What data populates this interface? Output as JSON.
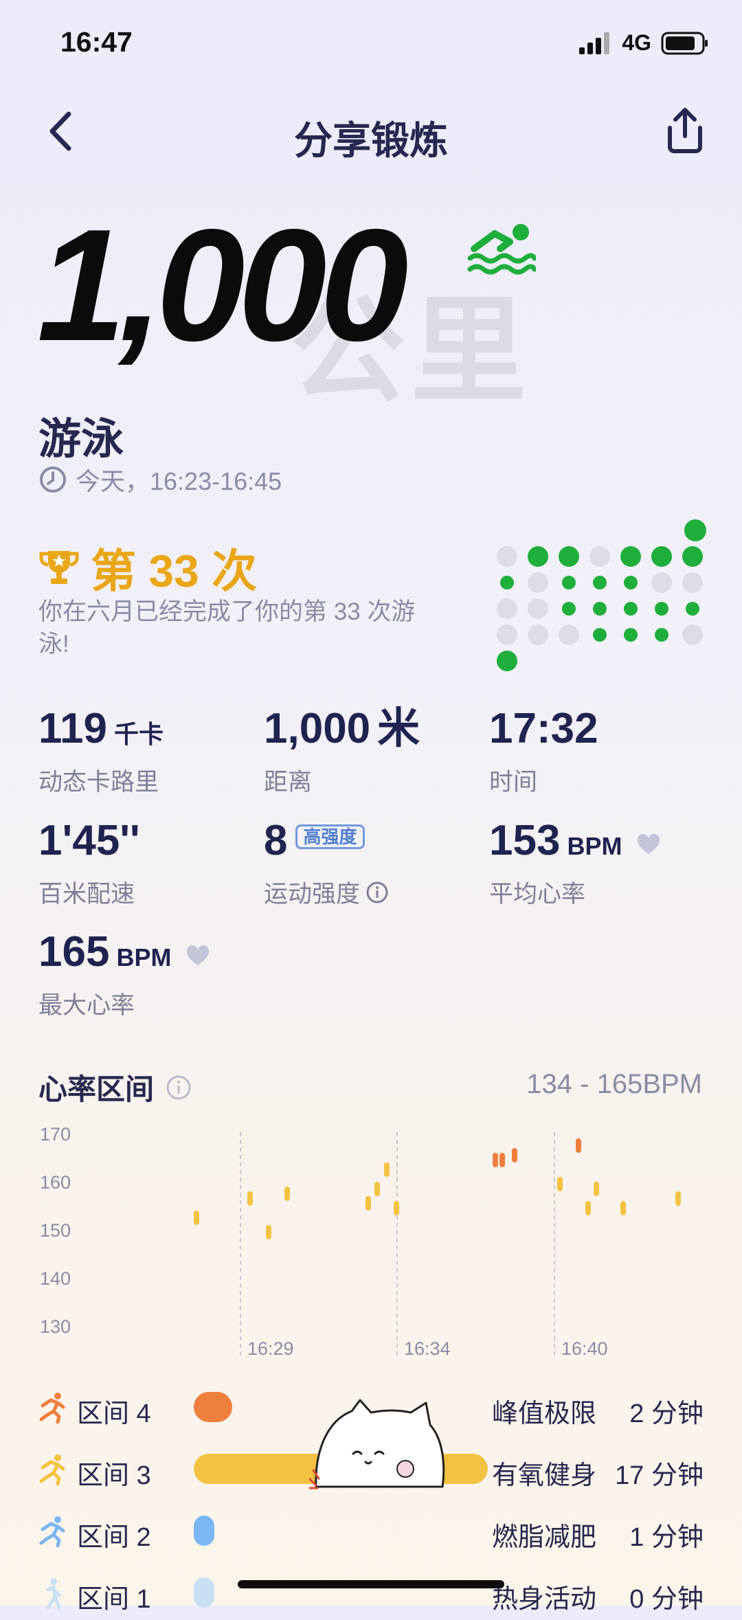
{
  "status_bar": {
    "time": "16:47",
    "network": "4G"
  },
  "nav": {
    "title": "分享锻炼",
    "back_icon": "chevron-left-icon",
    "share_icon": "share-icon"
  },
  "hero": {
    "distance": "1,000",
    "unit_watermark": "公里",
    "sport_icon": "swimming-icon",
    "accent_color": "#1fae3c"
  },
  "sport": {
    "name": "游泳",
    "time_range": "今天，16:23-16:45"
  },
  "achievement": {
    "title": "第 33 次",
    "description": "你在六月已经完成了你的第 33 次游泳!"
  },
  "stats": {
    "calories": {
      "value": "119",
      "unit": "千卡",
      "label": "动态卡路里"
    },
    "distance": {
      "value": "1,000",
      "unit": "米",
      "label": "距离"
    },
    "duration": {
      "value": "17:32",
      "label": "时间"
    },
    "pace": {
      "value": "1'45''",
      "label": "百米配速"
    },
    "intensity": {
      "value": "8",
      "badge": "高强度",
      "label": "运动强度"
    },
    "avg_hr": {
      "value": "153",
      "unit": "BPM",
      "label": "平均心率"
    },
    "max_hr": {
      "value": "165",
      "unit": "BPM",
      "label": "最大心率"
    }
  },
  "heart_rate": {
    "title": "心率区间",
    "range": "134 - 165BPM"
  },
  "chart_data": {
    "type": "scatter",
    "y_ticks": [
      "170",
      "160",
      "150",
      "140",
      "130"
    ],
    "x_ticks": [
      "16:29",
      "16:34",
      "16:40"
    ],
    "ylim": [
      130,
      170
    ],
    "grid": "vertical dashed lines at x ticks",
    "colors": {
      "zone3": "#f4c242",
      "zone4": "#ee7f3d"
    }
  },
  "zones": [
    {
      "name": "区间 4",
      "desc": "峰值极限",
      "duration": "2 分钟",
      "color": "#ee7f3d",
      "icon": "runner-icon",
      "fraction": 0.13
    },
    {
      "name": "区间 3",
      "desc": "有氧健身",
      "duration": "17 分钟",
      "color": "#f4c242",
      "icon": "runner-icon",
      "fraction": 1.0
    },
    {
      "name": "区间 2",
      "desc": "燃脂减肥",
      "duration": "1 分钟",
      "color": "#7cb6f5",
      "icon": "runner-icon",
      "fraction": 0.06
    },
    {
      "name": "区间 1",
      "desc": "热身活动",
      "duration": "0 分钟",
      "color": "#c9dff4",
      "icon": "walker-icon",
      "fraction": 0.0
    }
  ]
}
